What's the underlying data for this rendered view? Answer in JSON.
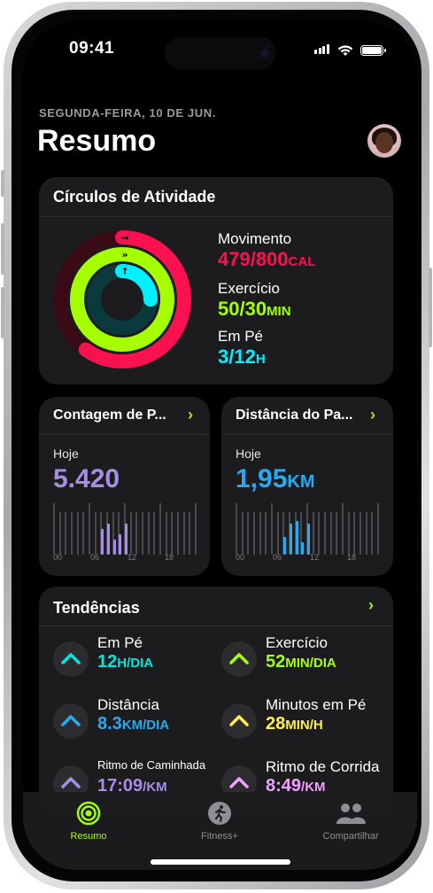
{
  "status": {
    "time": "09:41"
  },
  "header": {
    "date": "SEGUNDA-FEIRA, 10 DE JUN.",
    "title": "Resumo"
  },
  "activity": {
    "title": "Círculos de Atividade",
    "move": {
      "label": "Movimento",
      "value": "479/800",
      "unit": "CAL",
      "progress": 0.6,
      "color": "#fa114f"
    },
    "exercise": {
      "label": "Exercício",
      "value": "50/30",
      "unit": "MIN",
      "progress": 1.67,
      "color": "#a6ff00"
    },
    "stand": {
      "label": "Em Pé",
      "value": "3/12",
      "unit": "H",
      "progress": 0.25,
      "color": "#00f0ff"
    }
  },
  "steps": {
    "title": "Contagem de P...",
    "today_label": "Hoje",
    "value": "5.420",
    "color": "#a58ee6",
    "ticks": [
      "00",
      "06",
      "12",
      "18"
    ],
    "bars": [
      0,
      0,
      0,
      0,
      0,
      0,
      0,
      0,
      0.5,
      0.6,
      0.3,
      0.4,
      0.6,
      0,
      0,
      0,
      0,
      0,
      0,
      0,
      0,
      0,
      0,
      0
    ]
  },
  "distance": {
    "title": "Distância do Pa...",
    "today_label": "Hoje",
    "value": "1,95",
    "unit": "KM",
    "color": "#28aaf0",
    "ticks": [
      "00",
      "06",
      "12",
      "18"
    ],
    "bars": [
      0,
      0,
      0,
      0,
      0,
      0,
      0,
      0,
      0.35,
      0.6,
      0.65,
      0.25,
      0.6,
      0,
      0,
      0,
      0,
      0,
      0,
      0,
      0,
      0,
      0,
      0
    ]
  },
  "trends": {
    "title": "Tendências",
    "items": [
      {
        "label": "Em Pé",
        "value": "12",
        "unit": "H/DIA",
        "color": "#00e5e0"
      },
      {
        "label": "Exercício",
        "value": "52",
        "unit": "MIN/DIA",
        "color": "#a6ff00"
      },
      {
        "label": "Distância",
        "value": "8.3",
        "unit": "KM/DIA",
        "color": "#28aaf0"
      },
      {
        "label": "Minutos em Pé",
        "value": "28",
        "unit": "MIN/H",
        "color": "#fff04a"
      },
      {
        "label": "Ritmo de Caminhada",
        "value": "17:09",
        "unit": "/KM",
        "color": "#a58ee6"
      },
      {
        "label": "Ritmo de Corrida",
        "value": "8:49",
        "unit": "/KM",
        "color": "#f2a0ff"
      }
    ]
  },
  "tabs": [
    {
      "label": "Resumo",
      "icon": "rings-icon",
      "active": true
    },
    {
      "label": "Fitness+",
      "icon": "runner-icon",
      "active": false
    },
    {
      "label": "Compartilhar",
      "icon": "people-icon",
      "active": false
    }
  ]
}
